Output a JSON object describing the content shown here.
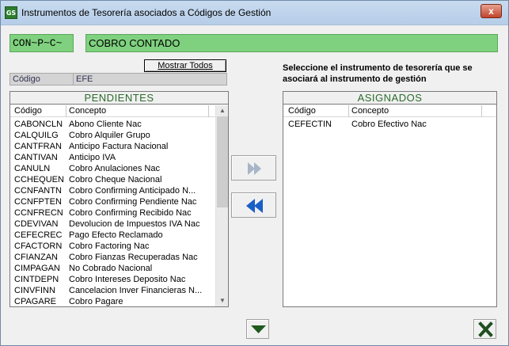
{
  "window": {
    "title": "Instrumentos de Tesorería asociados a Códigos de Gestión",
    "icon_text": "GS",
    "close_glyph": "x"
  },
  "header": {
    "code": "CON~P~C~",
    "name": "COBRO CONTADO"
  },
  "filter": {
    "show_all_label": "Mostrar Todos",
    "field_label": "Código",
    "field_value": "EFE"
  },
  "hint": "Seleccione el instrumento de tesorería que se asociará al instrumento de gestión",
  "pending": {
    "title": "PENDIENTES",
    "columns": [
      "Código",
      "Concepto"
    ],
    "rows": [
      [
        "CABONCLN",
        "Abono Cliente Nac"
      ],
      [
        "CALQUILG",
        "Cobro Alquiler Grupo"
      ],
      [
        "CANTFRAN",
        "Anticipo Factura Nacional"
      ],
      [
        "CANTIVAN",
        "Anticipo IVA"
      ],
      [
        "CANULN",
        "Cobro Anulaciones Nac"
      ],
      [
        "CCHEQUEN",
        "Cobro Cheque Nacional"
      ],
      [
        "CCNFANTN",
        "Cobro Confirming Anticipado N..."
      ],
      [
        "CCNFPTEN",
        "Cobro Confirming Pendiente Nac"
      ],
      [
        "CCNFRECN",
        "Cobro Confirming Recibido Nac"
      ],
      [
        "CDEVIVAN",
        "Devolucion de Impuestos IVA Nac"
      ],
      [
        "CEFECREC",
        "Pago Efecto Reclamado"
      ],
      [
        "CFACTORN",
        "Cobro Factoring Nac"
      ],
      [
        "CFIANZAN",
        "Cobro Fianzas Recuperadas Nac"
      ],
      [
        "CIMPAGAN",
        "No Cobrado Nacional"
      ],
      [
        "CINTDEPN",
        "Cobro Intereses Deposito Nac"
      ],
      [
        "CINVFINN",
        "Cancelacion Inver Financieras N..."
      ],
      [
        "CPAGARE",
        "Cobro Pagare"
      ]
    ]
  },
  "assigned": {
    "title": "ASIGNADOS",
    "columns": [
      "Código",
      "Concepto"
    ],
    "rows": [
      [
        "CEFECTIN",
        "Cobro Efectivo Nac"
      ]
    ]
  },
  "icons": {
    "assign": "double-chevron-right-icon",
    "unassign": "double-chevron-left-icon",
    "down": "triangle-down-icon",
    "close": "x-close-icon"
  },
  "colors": {
    "header_green": "#7fd17f",
    "panel_title_green": "#2c6b2c",
    "arrow_blue": "#1a5fc8"
  }
}
